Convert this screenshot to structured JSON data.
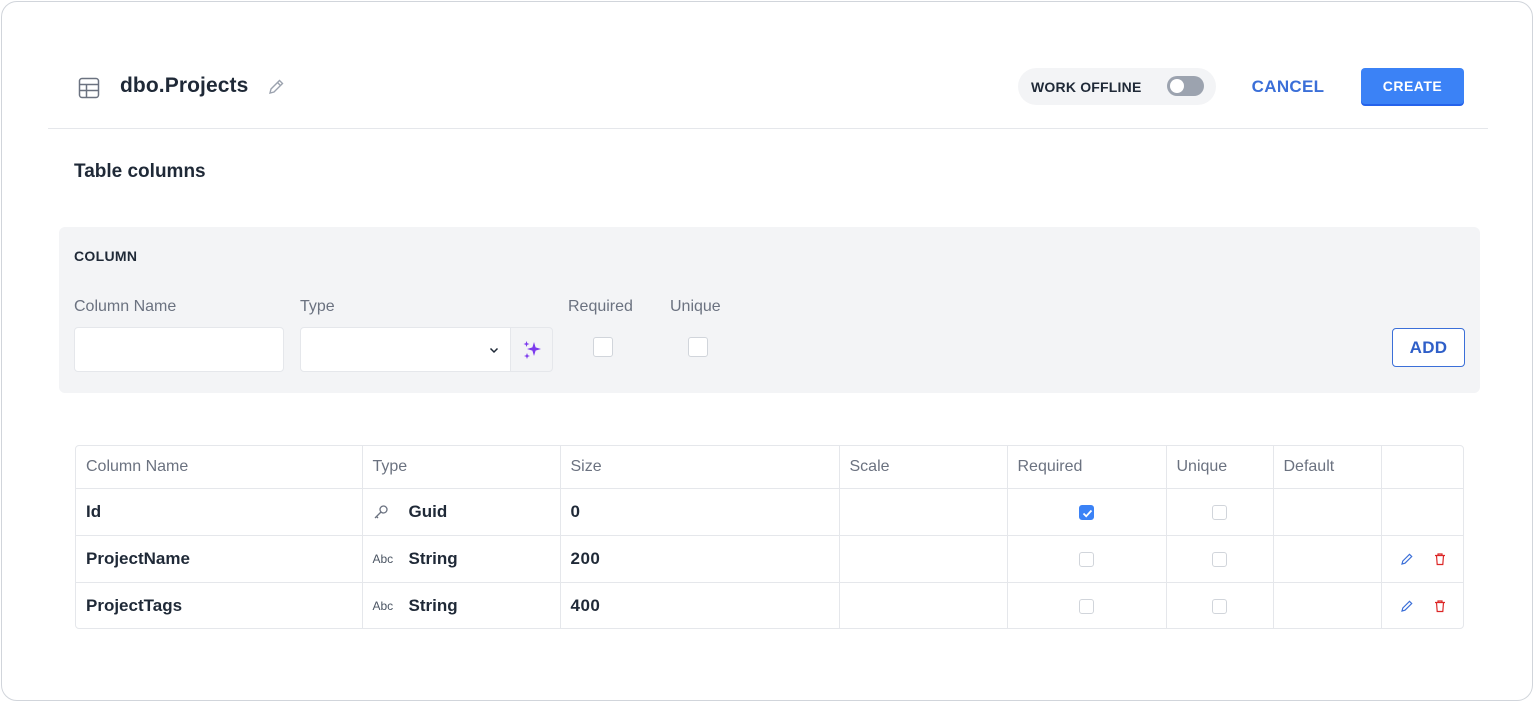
{
  "header": {
    "title": "dbo.Projects",
    "work_offline_label": "WORK OFFLINE",
    "work_offline_enabled": false,
    "cancel_label": "CANCEL",
    "create_label": "CREATE"
  },
  "section_title": "Table columns",
  "column_form": {
    "panel_title": "COLUMN",
    "column_name_label": "Column Name",
    "column_name_value": "",
    "type_label": "Type",
    "type_value": "",
    "required_label": "Required",
    "required_checked": false,
    "unique_label": "Unique",
    "unique_checked": false,
    "add_label": "ADD"
  },
  "table": {
    "headers": [
      "Column Name",
      "Type",
      "Size",
      "Scale",
      "Required",
      "Unique",
      "Default",
      ""
    ],
    "rows": [
      {
        "name": "Id",
        "type_icon": "key-icon",
        "type": "Guid",
        "size": "0",
        "scale": "",
        "required": true,
        "unique": false,
        "default": "",
        "editable": false
      },
      {
        "name": "ProjectName",
        "type_icon": "Abc",
        "type": "String",
        "size": "200",
        "scale": "",
        "required": false,
        "unique": false,
        "default": "",
        "editable": true
      },
      {
        "name": "ProjectTags",
        "type_icon": "Abc",
        "type": "String",
        "size": "400",
        "scale": "",
        "required": false,
        "unique": false,
        "default": "",
        "editable": true
      }
    ]
  },
  "colors": {
    "accent": "#3b82f6",
    "link": "#3b6fd8",
    "delete": "#dc2626",
    "magic": "#7c3aed"
  }
}
